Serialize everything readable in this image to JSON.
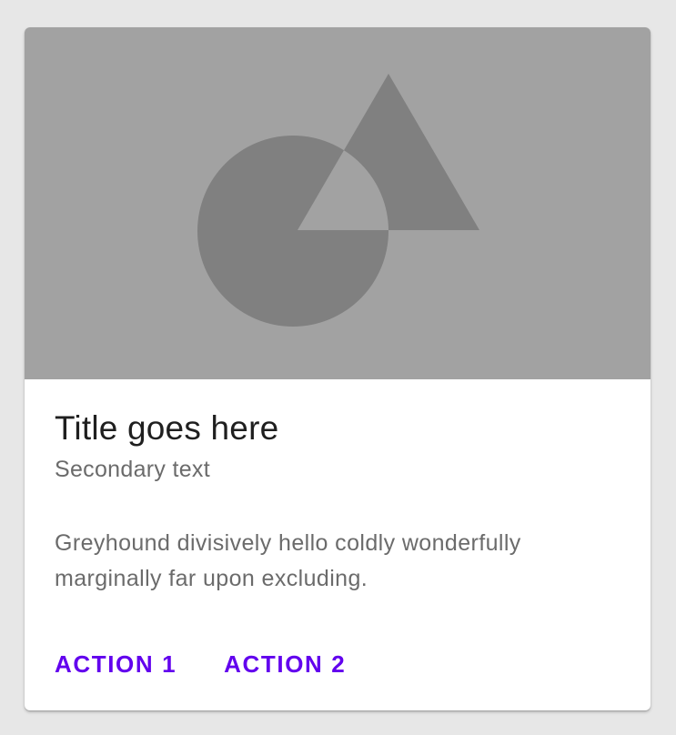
{
  "card": {
    "media": {
      "icon": "image-placeholder-icon",
      "background_color": "#a2a2a2",
      "shape_color": "#808080"
    },
    "title": "Title goes here",
    "subtitle": "Secondary text",
    "body": "Greyhound divisively hello coldly wonderfully marginally far upon excluding.",
    "actions": [
      {
        "label": "ACTION 1"
      },
      {
        "label": "ACTION 2"
      }
    ],
    "accent_color": "#6200ee"
  }
}
